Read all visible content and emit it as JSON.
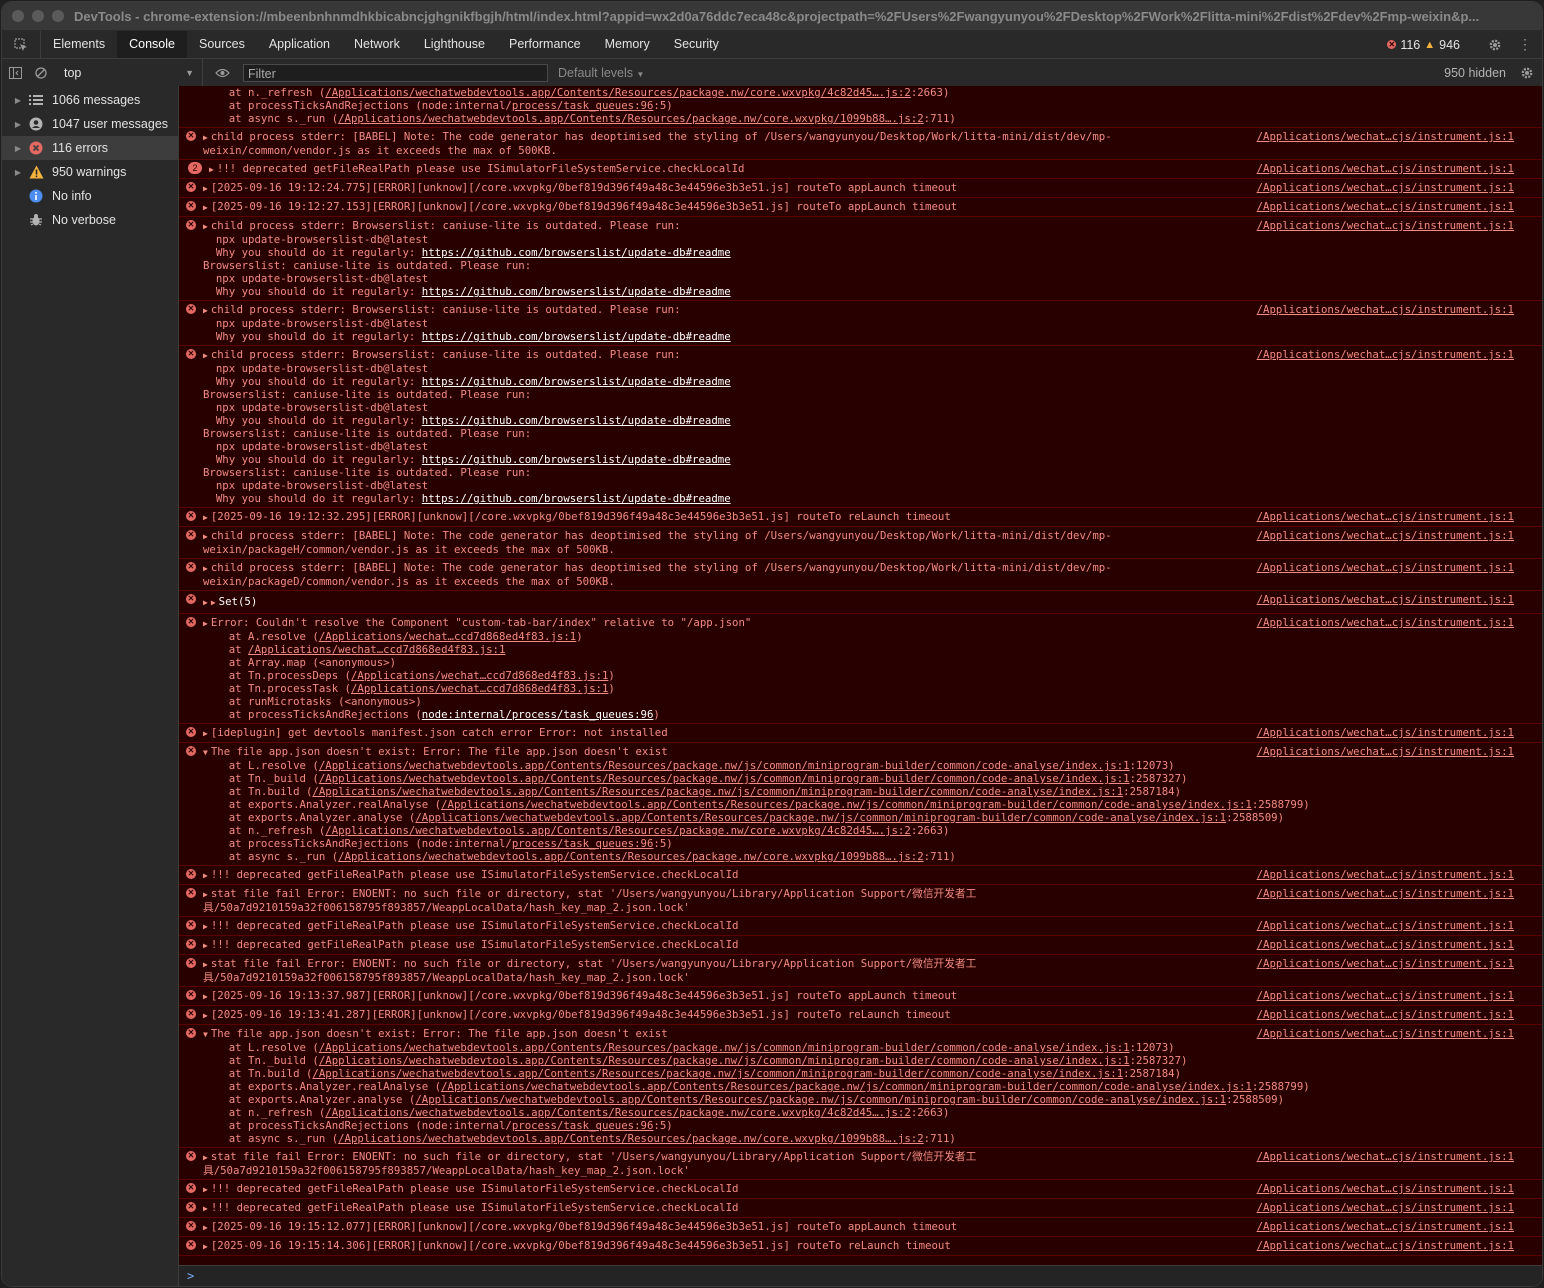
{
  "window": {
    "title": "DevTools - chrome-extension://mbeenbnhnmdhkbicabncjghgnikfbgjh/html/index.html?appid=wx2d0a76ddc7eca48c&projectpath=%2FUsers%2Fwangyunyou%2FDesktop%2FWork%2Flitta-mini%2Fdist%2Fdev%2Fmp-weixin&p..."
  },
  "tabs": [
    {
      "label": "Elements",
      "active": false
    },
    {
      "label": "Console",
      "active": true
    },
    {
      "label": "Sources",
      "active": false
    },
    {
      "label": "Application",
      "active": false
    },
    {
      "label": "Network",
      "active": false
    },
    {
      "label": "Lighthouse",
      "active": false
    },
    {
      "label": "Performance",
      "active": false
    },
    {
      "label": "Memory",
      "active": false
    },
    {
      "label": "Security",
      "active": false
    }
  ],
  "counts": {
    "errors": "116",
    "warnings": "946"
  },
  "toolbar": {
    "context": "top",
    "filter_placeholder": "Filter",
    "levels": "Default levels",
    "hidden": "950 hidden"
  },
  "sidebar": {
    "items": [
      {
        "label": "1066 messages",
        "icon": "list-icon"
      },
      {
        "label": "1047 user messages",
        "icon": "user-icon"
      },
      {
        "label": "116 errors",
        "icon": "error-icon"
      },
      {
        "label": "950 warnings",
        "icon": "warning-icon"
      },
      {
        "label": "No info",
        "icon": "info-icon"
      },
      {
        "label": "No verbose",
        "icon": "bug-icon"
      }
    ]
  },
  "src": "/Applications/wechat…cjs/instrument.js:1",
  "messages": {
    "m0": {
      "l1": "    at n._refresh (",
      "u1": "/Applications/wechatwebdevtools.app/Contents/Resources/package.nw/core.wxvpkg/4c82d45….js:2",
      "t1": ":2663)",
      "l2": "    at processTicksAndRejections (node:internal/",
      "u2": "process/task_queues:96",
      "t2": ":5)",
      "l3": "    at async s._run (",
      "u3": "/Applications/wechatwebdevtools.app/Contents/Resources/package.nw/core.wxvpkg/1099b88….js:2",
      "t3": ":711)"
    },
    "m1": {
      "l1": "child process stderr: [BABEL] Note: The code generator has deoptimised the styling of /Users/wangyunyou/Desktop/Work/litta-mini/dist/dev/mp-",
      "l2": "weixin/common/vendor.js as it exceeds the max of 500KB."
    },
    "m2": {
      "badge": "2",
      "l1": "!!! deprecated getFileRealPath please use ISimulatorFileSystemService.checkLocalId"
    },
    "m3": {
      "l1": "[2025-09-16 19:12:24.775][ERROR][unknow][/core.wxvpkg/0bef819d396f49a48c3e44596e3b3e51.js] routeTo appLaunch timeout"
    },
    "m4": {
      "l1": "[2025-09-16 19:12:27.153][ERROR][unknow][/core.wxvpkg/0bef819d396f49a48c3e44596e3b3e51.js] routeTo appLaunch timeout"
    },
    "bl": {
      "a": "child process stderr: Browserslist: caniuse-lite is outdated. Please run:",
      "b": "  npx update-browserslist-db@latest",
      "c": "  Why you should do it regularly: ",
      "url": "https://github.com/browserslist/update-db#readme",
      "d": "Browserslist: caniuse-lite is outdated. Please run:"
    },
    "m8": {
      "l1": "[2025-09-16 19:12:32.295][ERROR][unknow][/core.wxvpkg/0bef819d396f49a48c3e44596e3b3e51.js] routeTo reLaunch timeout"
    },
    "m9": {
      "l1": "child process stderr: [BABEL] Note: The code generator has deoptimised the styling of /Users/wangyunyou/Desktop/Work/litta-mini/dist/dev/mp-",
      "l2": "weixin/packageH/common/vendor.js as it exceeds the max of 500KB."
    },
    "m10": {
      "l1": "child process stderr: [BABEL] Note: The code generator has deoptimised the styling of /Users/wangyunyou/Desktop/Work/litta-mini/dist/dev/mp-",
      "l2": "weixin/packageD/common/vendor.js as it exceeds the max of 500KB."
    },
    "m11": {
      "l1": "Set(5)"
    },
    "m12": {
      "l1": "Error: Couldn't resolve the Component \"custom-tab-bar/index\" relative to \"/app.json\"",
      "l2a": "    at A.resolve (",
      "l2u": "/Applications/wechat…ccd7d868ed4f83.js:1",
      "l2b": ")",
      "l3a": "    at ",
      "l3u": "/Applications/wechat…ccd7d868ed4f83.js:1",
      "l4": "    at Array.map (<anonymous>)",
      "l5a": "    at Tn.processDeps (",
      "l5u": "/Applications/wechat…ccd7d868ed4f83.js:1",
      "l6a": "    at Tn.processTask (",
      "l6u": "/Applications/wechat…ccd7d868ed4f83.js:1",
      "l7": "    at runMicrotasks (<anonymous>)",
      "l8a": "    at processTicksAndRejections (",
      "l8u": "node:internal/process/task_queues:96",
      "l8b": ")"
    },
    "m13": {
      "l1": "[ideplugin] get devtools manifest.json catch error Error: not installed"
    },
    "fnf": {
      "l1": "The file app.json doesn't exist: Error: The file app.json doesn't exist",
      "a1": "    at L.resolve (",
      "u1": "/Applications/wechatwebdevtools.app/Contents/Resources/package.nw/js/common/miniprogram-builder/common/code-analyse/index.js:1",
      "t1": ":12073)",
      "a2": "    at Tn._build (",
      "u2": "/Applications/wechatwebdevtools.app/Contents/Resources/package.nw/js/common/miniprogram-builder/common/code-analyse/index.js:1",
      "t2": ":2587327)",
      "a3": "    at Tn.build (",
      "u3": "/Applications/wechatwebdevtools.app/Contents/Resources/package.nw/js/common/miniprogram-builder/common/code-analyse/index.js:1",
      "t3": ":2587184)",
      "a4": "    at exports.Analyzer.realAnalyse (",
      "u4": "/Applications/wechatwebdevtools.app/Contents/Resources/package.nw/js/common/miniprogram-builder/common/code-analyse/index.js:1",
      "t4": ":2588799)",
      "a5": "    at exports.Analyzer.analyse (",
      "u5": "/Applications/wechatwebdevtools.app/Contents/Resources/package.nw/js/common/miniprogram-builder/common/code-analyse/index.js:1",
      "t5": ":2588509)"
    },
    "dep": {
      "l1": "!!! deprecated getFileRealPath please use ISimulatorFileSystemService.checkLocalId"
    },
    "stat": {
      "l1": "stat file fail Error: ENOENT: no such file or directory, stat '/Users/wangyunyou/Library/Application Support/微信开发者工",
      "l2": "具/50a7d9210159a32f006158795f893857/WeappLocalData/hash_key_map_2.json.lock'"
    },
    "m22": {
      "l1": "[2025-09-16 19:13:37.987][ERROR][unknow][/core.wxvpkg/0bef819d396f49a48c3e44596e3b3e51.js] routeTo appLaunch timeout"
    },
    "m23": {
      "l1": "[2025-09-16 19:13:41.287][ERROR][unknow][/core.wxvpkg/0bef819d396f49a48c3e44596e3b3e51.js] routeTo reLaunch timeout"
    },
    "m28": {
      "l1": "[2025-09-16 19:15:12.077][ERROR][unknow][/core.wxvpkg/0bef819d396f49a48c3e44596e3b3e51.js] routeTo appLaunch timeout"
    },
    "m29": {
      "l1": "[2025-09-16 19:15:14.306][ERROR][unknow][/core.wxvpkg/0bef819d396f49a48c3e44596e3b3e51.js] routeTo reLaunch timeout"
    }
  },
  "prompt": ">"
}
